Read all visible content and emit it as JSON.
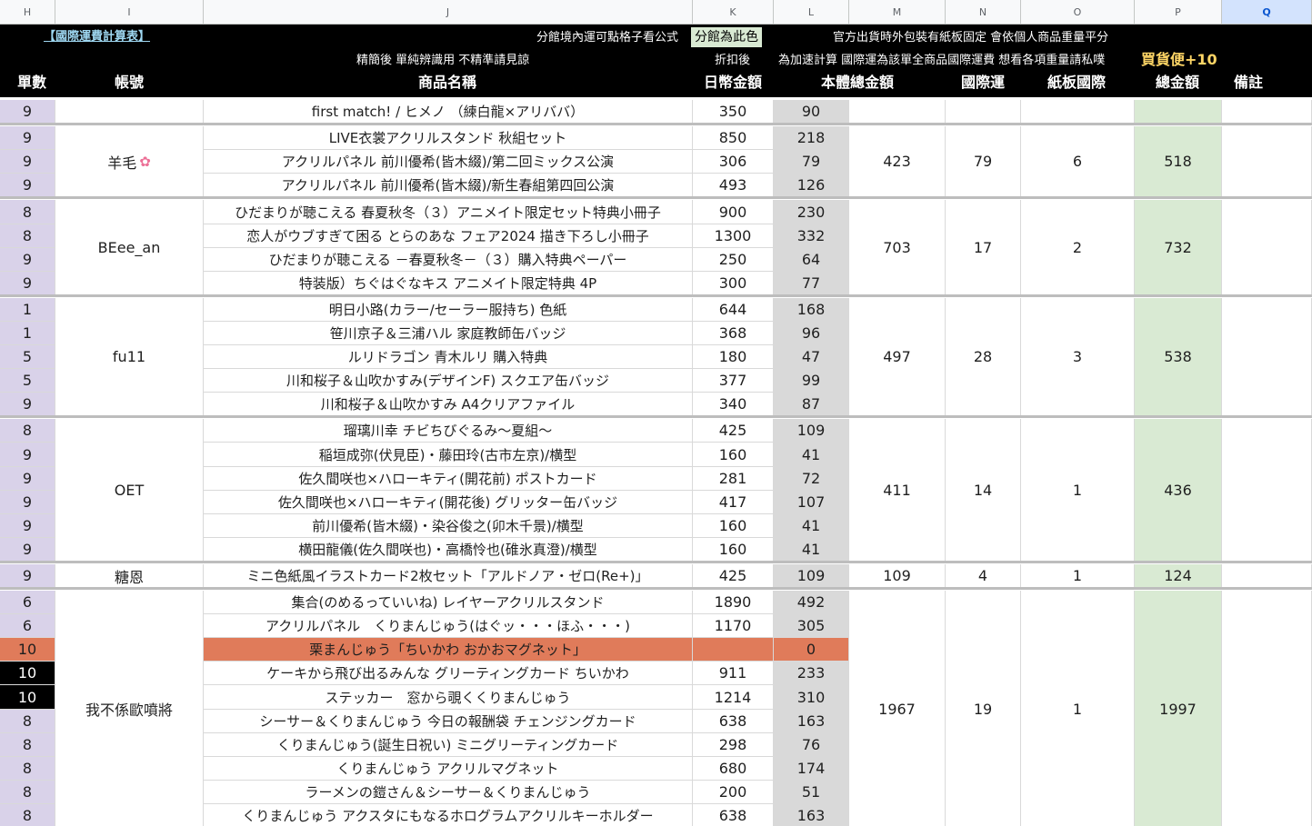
{
  "column_letters": [
    "H",
    "I",
    "J",
    "K",
    "L",
    "M",
    "N",
    "O",
    "P",
    "Q"
  ],
  "selected_column": "Q",
  "header": {
    "title_link": "【國際運費計算表】",
    "note_formula": "分館境內運可點格子看公式",
    "note_branch_color": "分館為此色",
    "note_official": "官方出貨時外包裝有紙板固定 會依個人商品重量平分",
    "note_simplified": "精簡後 單純辨識用 不精準請見諒",
    "note_discount": "折扣後",
    "note_express": "為加速計算 國際運為該單全商品國際運費 想看各項重量請私噗",
    "note_buy_plus": "買貨便+10",
    "col_h": "單數",
    "col_i": "帳號",
    "col_j": "商品名稱",
    "col_k": "日幣金額",
    "col_l": "本體總金額",
    "col_n": "國際運",
    "col_o": "紙板國際",
    "col_p": "總金額",
    "col_q": "備註"
  },
  "groups": [
    {
      "account": "",
      "subtotal": "",
      "intl": "",
      "board": "",
      "total": "",
      "items": [
        {
          "n": "9",
          "name": "first match! / ヒメノ （練白龍×アリババ）",
          "jpy": "350",
          "twd": "90"
        }
      ]
    },
    {
      "account": "羊毛",
      "account_icon": "cherry-blossom-icon",
      "subtotal": "423",
      "intl": "79",
      "board": "6",
      "total": "518",
      "items": [
        {
          "n": "9",
          "name": "LIVE衣裳アクリルスタンド 秋組セット",
          "jpy": "850",
          "twd": "218"
        },
        {
          "n": "9",
          "name": "アクリルパネル 前川優希(皆木綴)/第二回ミックス公演",
          "jpy": "306",
          "twd": "79"
        },
        {
          "n": "9",
          "name": "アクリルパネル 前川優希(皆木綴)/新生春組第四回公演",
          "jpy": "493",
          "twd": "126"
        }
      ]
    },
    {
      "account": "BEee_an",
      "subtotal": "703",
      "intl": "17",
      "board": "2",
      "total": "732",
      "items": [
        {
          "n": "8",
          "name": "ひだまりが聴こえる 春夏秋冬（３）アニメイト限定セット特典小冊子",
          "jpy": "900",
          "twd": "230"
        },
        {
          "n": "8",
          "name": "恋人がウブすぎて困る とらのあな フェア2024 描き下ろし小冊子",
          "jpy": "1300",
          "twd": "332"
        },
        {
          "n": "9",
          "name": "ひだまりが聴こえる －春夏秋冬－（３）購入特典ペーパー",
          "jpy": "250",
          "twd": "64"
        },
        {
          "n": "9",
          "name": "特装版）ちぐはぐなキス アニメイト限定特典 4P",
          "jpy": "300",
          "twd": "77"
        }
      ]
    },
    {
      "account": "fu11",
      "subtotal": "497",
      "intl": "28",
      "board": "3",
      "total": "538",
      "items": [
        {
          "n": "1",
          "name": "明日小路(カラー/セーラー服持ち) 色紙",
          "jpy": "644",
          "twd": "168"
        },
        {
          "n": "1",
          "name": "笹川京子＆三浦ハル 家庭教師缶バッジ",
          "jpy": "368",
          "twd": "96"
        },
        {
          "n": "5",
          "name": "ルリドラゴン 青木ルリ 購入特典",
          "jpy": "180",
          "twd": "47"
        },
        {
          "n": "5",
          "name": "川和桜子＆山吹かすみ(デザインF) スクエア缶バッジ",
          "jpy": "377",
          "twd": "99"
        },
        {
          "n": "9",
          "name": "川和桜子＆山吹かすみ A4クリアファイル",
          "jpy": "340",
          "twd": "87"
        }
      ]
    },
    {
      "account": "OET",
      "subtotal": "411",
      "intl": "14",
      "board": "1",
      "total": "436",
      "items": [
        {
          "n": "8",
          "name": "瑠璃川幸 チビちびぐるみ～夏組～",
          "jpy": "425",
          "twd": "109"
        },
        {
          "n": "9",
          "name": "稲垣成弥(伏見臣)・藤田玲(古市左京)/横型",
          "jpy": "160",
          "twd": "41"
        },
        {
          "n": "9",
          "name": "佐久間咲也×ハローキティ(開花前) ポストカード",
          "jpy": "281",
          "twd": "72"
        },
        {
          "n": "9",
          "name": "佐久間咲也×ハローキティ(開花後) グリッター缶バッジ",
          "jpy": "417",
          "twd": "107"
        },
        {
          "n": "9",
          "name": "前川優希(皆木綴)・染谷俊之(卯木千景)/横型",
          "jpy": "160",
          "twd": "41"
        },
        {
          "n": "9",
          "name": "横田龍儀(佐久間咲也)・高橋怜也(碓氷真澄)/横型",
          "jpy": "160",
          "twd": "41"
        }
      ]
    },
    {
      "account": "糖恩",
      "subtotal": "109",
      "intl": "4",
      "board": "1",
      "total": "124",
      "items": [
        {
          "n": "9",
          "name": "ミニ色紙風イラストカード2枚セット「アルドノア・ゼロ(Re+)」",
          "jpy": "425",
          "twd": "109"
        }
      ]
    },
    {
      "account": "我不係歐噴將",
      "subtotal": "1967",
      "intl": "19",
      "board": "1",
      "total": "1997",
      "items": [
        {
          "n": "6",
          "name": "集合(のめるっていいね) レイヤーアクリルスタンド",
          "jpy": "1890",
          "twd": "492"
        },
        {
          "n": "6",
          "name": "アクリルパネル　くりまんじゅう(はぐッ・・・ほふ・・・)",
          "jpy": "1170",
          "twd": "305"
        },
        {
          "n": "10",
          "name": "栗まんじゅう「ちいかわ おかおマグネット」",
          "jpy": "",
          "twd": "0",
          "status": "cancelled"
        },
        {
          "n": "10",
          "name": "ケーキから飛び出るみんな グリーティングカード ちいかわ",
          "jpy": "911",
          "twd": "233",
          "status": "black"
        },
        {
          "n": "10",
          "name": "ステッカー　窓から覗くくりまんじゅう",
          "jpy": "1214",
          "twd": "310",
          "status": "black"
        },
        {
          "n": "8",
          "name": "シーサー＆くりまんじゅう 今日の報酬袋 チェンジングカード",
          "jpy": "638",
          "twd": "163"
        },
        {
          "n": "8",
          "name": "くりまんじゅう(誕生日祝い) ミニグリーティングカード",
          "jpy": "298",
          "twd": "76"
        },
        {
          "n": "8",
          "name": "くりまんじゅう アクリルマグネット",
          "jpy": "680",
          "twd": "174"
        },
        {
          "n": "8",
          "name": "ラーメンの鎧さん＆シーサー＆くりまんじゅう",
          "jpy": "200",
          "twd": "51"
        },
        {
          "n": "8",
          "name": "くりまんじゅう アクスタにもなるホログラムアクリルキーホルダー",
          "jpy": "638",
          "twd": "163"
        }
      ]
    }
  ],
  "colors": {
    "header_bg": "#000000",
    "count_cell": "#d9d2e9",
    "body_total_cell": "#d9d9d9",
    "total_cell": "#d9ead3",
    "cancelled_row": "#e07b5a",
    "black_count": "#000000",
    "selected_column": "#d3e3fd"
  }
}
